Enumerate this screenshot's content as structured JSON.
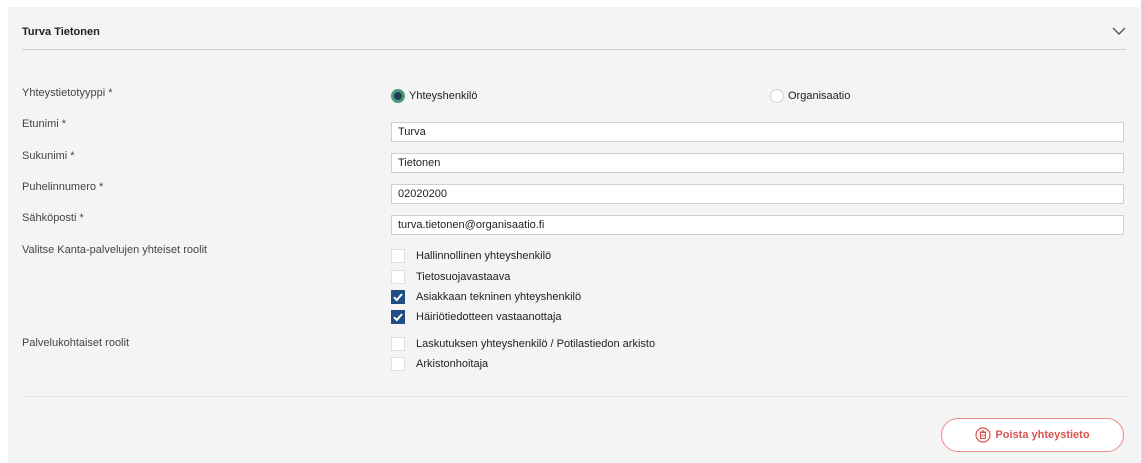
{
  "header": {
    "title": "Turva Tietonen",
    "toggle_icon": "chevron-down-icon"
  },
  "form": {
    "contact_type": {
      "label": "Yhteystietotyyppi  *",
      "options": [
        {
          "label": "Yhteyshenkilö",
          "selected": true
        },
        {
          "label": "Organisaatio",
          "selected": false
        }
      ]
    },
    "first_name": {
      "label": "Etunimi *",
      "value": "Turva"
    },
    "last_name": {
      "label": "Sukunimi *",
      "value": "Tietonen"
    },
    "phone": {
      "label": "Puhelinnumero *",
      "value": "02020200"
    },
    "email": {
      "label": "Sähköposti *",
      "value": "turva.tietonen@organisaatio.fi"
    },
    "common_roles": {
      "label": "Valitse Kanta-palvelujen yhteiset roolit",
      "items": [
        {
          "label": "Hallinnollinen yhteyshenkilö",
          "checked": false
        },
        {
          "label": "Tietosuojavastaava",
          "checked": false
        },
        {
          "label": "Asiakkaan tekninen yhteyshenkilö",
          "checked": true
        },
        {
          "label": "Häiriötiedotteen vastaanottaja",
          "checked": true
        }
      ]
    },
    "service_roles": {
      "label": "Palvelukohtaiset roolit",
      "items": [
        {
          "label": "Laskutuksen yhteyshenkilö / Potilastiedon arkisto",
          "checked": false
        },
        {
          "label": "Arkistonhoitaja",
          "checked": false
        }
      ]
    }
  },
  "actions": {
    "delete_label": "Poista yhteystieto",
    "delete_icon": "trash-icon"
  },
  "colors": {
    "accent": "#1f4d85",
    "radio_ring": "#4a9a7d",
    "danger": "#d9534f",
    "panel_bg": "#f4f4f4"
  }
}
